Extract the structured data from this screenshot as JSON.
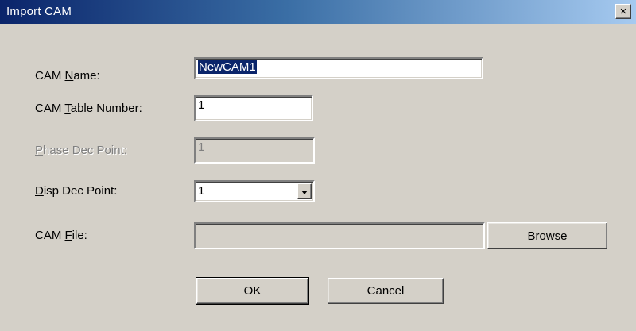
{
  "window": {
    "title": "Import CAM",
    "close_glyph": "×"
  },
  "form": {
    "cam_name": {
      "label_pre": "CAM ",
      "label_key": "N",
      "label_post": "ame:",
      "value": "NewCAM1"
    },
    "cam_table_number": {
      "label_pre": "CAM ",
      "label_key": "T",
      "label_post": "able Number:",
      "value": "1"
    },
    "phase_dec_point": {
      "label_pre": "",
      "label_key": "P",
      "label_post": "hase Dec Point:",
      "value": "1",
      "enabled": false
    },
    "disp_dec_point": {
      "label_pre": "",
      "label_key": "D",
      "label_post": "isp Dec Point:",
      "value": "1"
    },
    "cam_file": {
      "label_pre": "CAM ",
      "label_key": "F",
      "label_post": "ile:",
      "value": ""
    }
  },
  "buttons": {
    "browse": "Browse",
    "ok": "OK",
    "cancel": "Cancel"
  },
  "colors": {
    "title_start": "#0a246a",
    "title_end": "#a6caf0",
    "face": "#d4d0c8",
    "selection": "#0a246a"
  },
  "icons": {
    "close": "close-icon",
    "dropdown": "chevron-down-icon"
  }
}
